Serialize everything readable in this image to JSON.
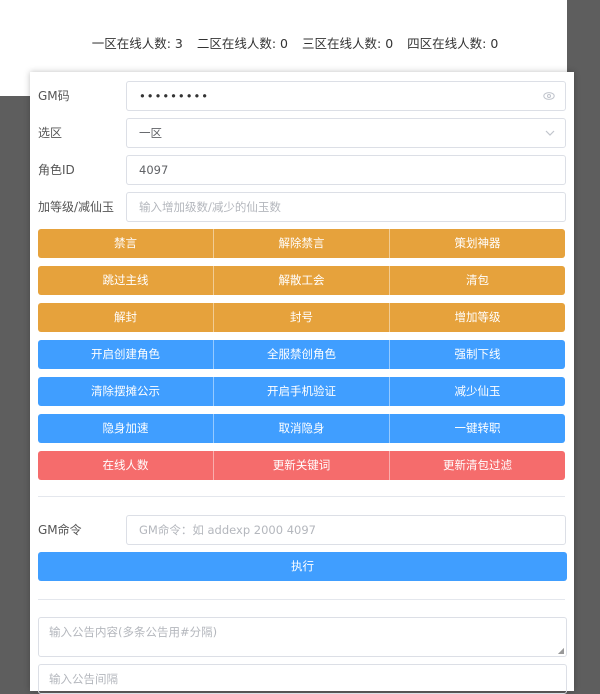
{
  "colors": {
    "orange": "#e6a23c",
    "blue": "#409eff",
    "red": "#f56c6c"
  },
  "online": [
    {
      "label": "一区在线人数:",
      "value": "3"
    },
    {
      "label": "二区在线人数:",
      "value": "0"
    },
    {
      "label": "三区在线人数:",
      "value": "0"
    },
    {
      "label": "四区在线人数:",
      "value": "0"
    }
  ],
  "form": {
    "gm_code": {
      "label": "GM码",
      "value": "•••••••••",
      "icon": "eye-icon"
    },
    "zone": {
      "label": "选区",
      "value": "一区",
      "icon": "chevron-down-icon"
    },
    "role_id": {
      "label": "角色ID",
      "value": "4097"
    },
    "level": {
      "label": "加等级/减仙玉",
      "placeholder": "输入增加级数/减少的仙玉数"
    }
  },
  "button_rows": [
    {
      "color": "orange",
      "buttons": [
        "禁言",
        "解除禁言",
        "策划神器"
      ]
    },
    {
      "color": "orange",
      "buttons": [
        "跳过主线",
        "解散工会",
        "清包"
      ]
    },
    {
      "color": "orange",
      "buttons": [
        "解封",
        "封号",
        "增加等级"
      ]
    },
    {
      "color": "blue",
      "buttons": [
        "开启创建角色",
        "全服禁创角色",
        "强制下线"
      ]
    },
    {
      "color": "blue",
      "buttons": [
        "清除摆摊公示",
        "开启手机验证",
        "减少仙玉"
      ]
    },
    {
      "color": "blue",
      "buttons": [
        "隐身加速",
        "取消隐身",
        "一键转职"
      ]
    },
    {
      "color": "red",
      "buttons": [
        "在线人数",
        "更新关键词",
        "更新清包过滤"
      ]
    }
  ],
  "gm_command": {
    "label": "GM命令",
    "placeholder": "GM命令：如 addexp 2000 4097",
    "execute": "执行"
  },
  "notice": {
    "content_placeholder": "输入公告内容(多条公告用#分隔)",
    "interval_placeholder": "输入公告间隔"
  }
}
